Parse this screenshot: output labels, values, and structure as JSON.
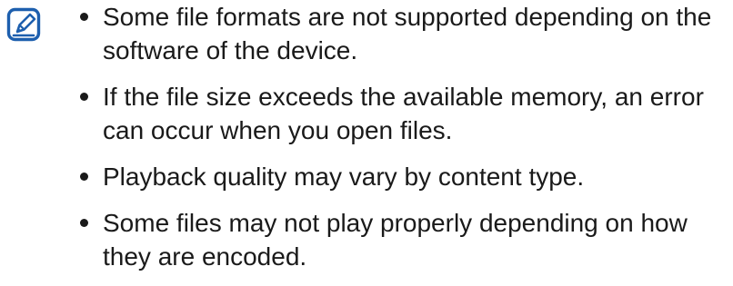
{
  "note": {
    "icon": "note-pencil-icon",
    "accent_color": "#1d5fae",
    "items": [
      "Some file formats are not supported depending on the software of the device.",
      "If the file size exceeds the available memory, an error can occur when you open files.",
      "Playback quality may vary by content type.",
      "Some files may not play properly depending on how they are encoded."
    ]
  }
}
